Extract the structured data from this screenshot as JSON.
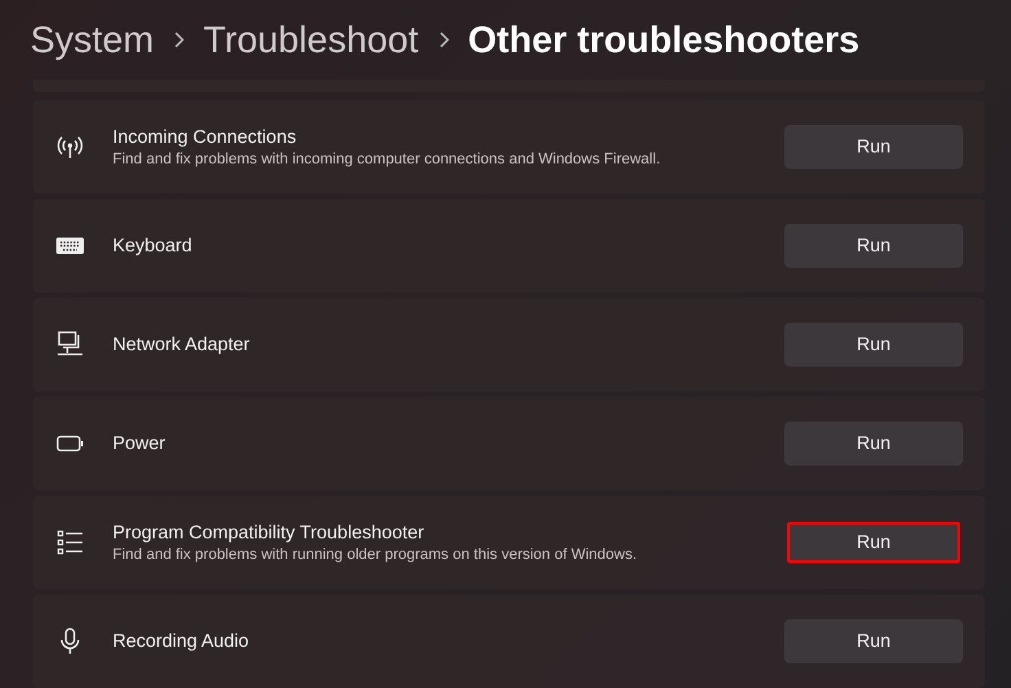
{
  "breadcrumb": [
    {
      "label": "System",
      "current": false
    },
    {
      "label": "Troubleshoot",
      "current": false
    },
    {
      "label": "Other troubleshooters",
      "current": true
    }
  ],
  "troubleshooters": [
    {
      "title": "Incoming Connections",
      "description": "Find and fix problems with incoming computer connections and Windows Firewall.",
      "button": "Run",
      "highlighted": false
    },
    {
      "title": "Keyboard",
      "button": "Run",
      "highlighted": false
    },
    {
      "title": "Network Adapter",
      "button": "Run",
      "highlighted": false
    },
    {
      "title": "Power",
      "button": "Run",
      "highlighted": false
    },
    {
      "title": "Program Compatibility Troubleshooter",
      "description": "Find and fix problems with running older programs on this version of Windows.",
      "button": "Run",
      "highlighted": true
    },
    {
      "title": "Recording Audio",
      "button": "Run",
      "highlighted": false
    }
  ]
}
